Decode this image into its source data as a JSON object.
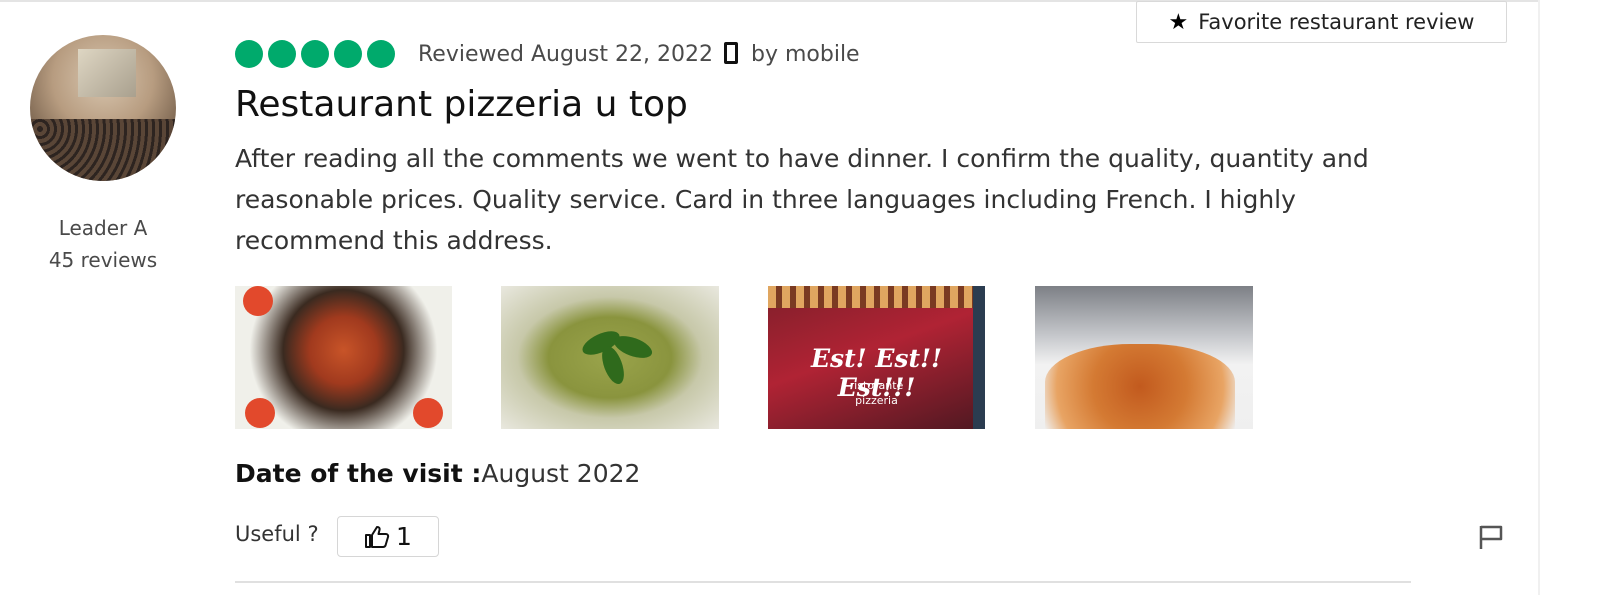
{
  "review": {
    "author": {
      "name": "Leader A",
      "reviews": "45 reviews"
    },
    "rating": {
      "value": 5,
      "max": 5,
      "color": "#00aa6c"
    },
    "reviewed_date": "Reviewed August 22, 2022",
    "device": "by mobile",
    "device_icon": "phone-icon",
    "favorite_button": "Favorite restaurant review",
    "title": "Restaurant pizzeria u top",
    "body": "After reading all the comments we went to have dinner. I confirm the quality, quantity and reasonable prices. Quality service. Card in three languages including French. I highly recommend this address.",
    "photos": [
      {
        "alt": "seafood-pasta-photo"
      },
      {
        "alt": "pesto-spaghetti-photo"
      },
      {
        "alt": "menu-card-photo",
        "text_main": "Est! Est!! Est!!!",
        "text_line1": "ristorante",
        "text_line2": "pizzeria"
      },
      {
        "alt": "lasagna-photo"
      }
    ],
    "visit": {
      "label": "Date of the visit :",
      "value": "August 2022"
    },
    "useful": {
      "label": "Useful ?",
      "count": "1"
    },
    "report_icon": "flag-icon"
  }
}
